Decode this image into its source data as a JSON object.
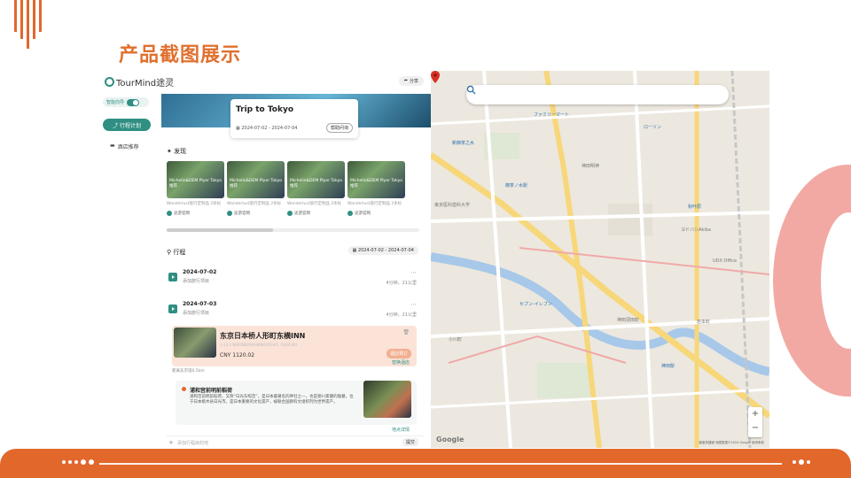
{
  "slide": {
    "title": "产品截图展示",
    "colors": {
      "accent": "#e0702e",
      "footer": "#e2672b",
      "ring": "#f2a9a3",
      "app_primary": "#2e8f82"
    }
  },
  "app": {
    "logo_text": "TourMind途灵",
    "share_label": "分享",
    "sidebar": {
      "toggle_label": "智能向导",
      "plan_button": "行程计划",
      "hotel_link": "酒店推荐"
    },
    "trip": {
      "title": "Trip to Tokyo",
      "dates": "2024-07-02 - 2024-07-04",
      "help_button": "帮助问询"
    },
    "discover": {
      "header": "发现",
      "cards": [
        {
          "title": "Michelin&DEM Plyer Tokyo推荐",
          "sub": "Wanderlust旅行定制品 2条标",
          "foot": "途游官网"
        },
        {
          "title": "Michelin&DEM Plyer Tokyo推荐",
          "sub": "Wanderlust旅行定制品 2条标",
          "foot": "途游官网"
        },
        {
          "title": "Michelin&DEM Plyer Tokyo推荐",
          "sub": "Wanderlust旅行定制品 2条标",
          "foot": "途游官网"
        },
        {
          "title": "Michelin&DEM Plyer Tokyo推荐",
          "sub": "Wanderlust旅行定制品 2条标",
          "foot": "途游官网"
        }
      ]
    },
    "itinerary": {
      "header": "行程",
      "date_chip": "2024-07-02 - 2024-07-04",
      "days": [
        {
          "date": "2024-07-02",
          "sub": "添加旅行项目",
          "meta": "4分钟，21公里"
        },
        {
          "date": "2024-07-03",
          "sub": "添加旅行项目",
          "meta": "4分钟，21公里"
        }
      ]
    },
    "hotel": {
      "name": "东京日本桥人形町东横INN",
      "address": "1-13-1 NIHONBASHI-NINGYOCHO, CHUO-KU",
      "price": "CNY 1120.02",
      "action": "酒店预订",
      "replace": "替换酒店",
      "distance": "距离东京塔0.5km"
    },
    "attraction": {
      "title": "浦和宫前明前稻荷",
      "description": "浦和宫前明前稻荷，又称“日光东照宫”，是日本最著名的神社之一，也是德川家康的陵墓，位于日本栃木县日光市。是日本重要的文化遗产，被联合国教科文组织列为世界遗产。",
      "link": "地点详情"
    },
    "add_row": {
      "placeholder": "添加行程目的地",
      "send": "提交"
    }
  },
  "map": {
    "search_placeholder": "",
    "google_logo": "Google",
    "attribution": "键盘快捷键 地图数据©2024 Google 使用条款",
    "labels": [
      {
        "text": "新御茶之水"
      },
      {
        "text": "御茶ノ水駅"
      },
      {
        "text": "神田明神"
      },
      {
        "text": "東京医科歯科大学"
      },
      {
        "text": "秋叶原"
      },
      {
        "text": "ヨドバシAkiba"
      },
      {
        "text": "UDX Office"
      },
      {
        "text": "ローソン"
      },
      {
        "text": "ファミリーマート"
      },
      {
        "text": "セブン-イレブン"
      },
      {
        "text": "神田須田町"
      },
      {
        "text": "神田駅"
      },
      {
        "text": "岩本町"
      },
      {
        "text": "小川町"
      }
    ]
  }
}
